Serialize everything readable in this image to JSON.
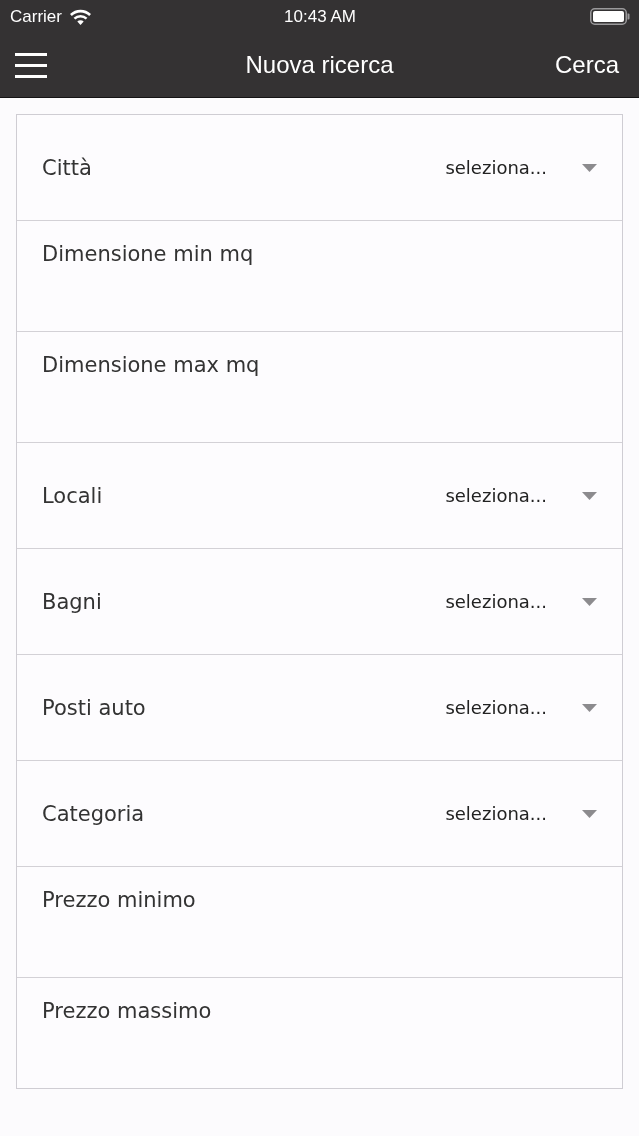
{
  "status_bar": {
    "carrier": "Carrier",
    "time": "10:43 AM"
  },
  "nav_bar": {
    "title": "Nuova ricerca",
    "action": "Cerca"
  },
  "form": {
    "fields": [
      {
        "kind": "select",
        "label": "Città",
        "placeholder": "seleziona..."
      },
      {
        "kind": "text",
        "label": "Dimensione min mq"
      },
      {
        "kind": "text",
        "label": "Dimensione max mq"
      },
      {
        "kind": "select",
        "label": "Locali",
        "placeholder": "seleziona..."
      },
      {
        "kind": "select",
        "label": "Bagni",
        "placeholder": "seleziona..."
      },
      {
        "kind": "select",
        "label": "Posti auto",
        "placeholder": "seleziona..."
      },
      {
        "kind": "select",
        "label": "Categoria",
        "placeholder": "seleziona..."
      },
      {
        "kind": "text",
        "label": "Prezzo minimo"
      },
      {
        "kind": "text",
        "label": "Prezzo massimo"
      }
    ]
  }
}
